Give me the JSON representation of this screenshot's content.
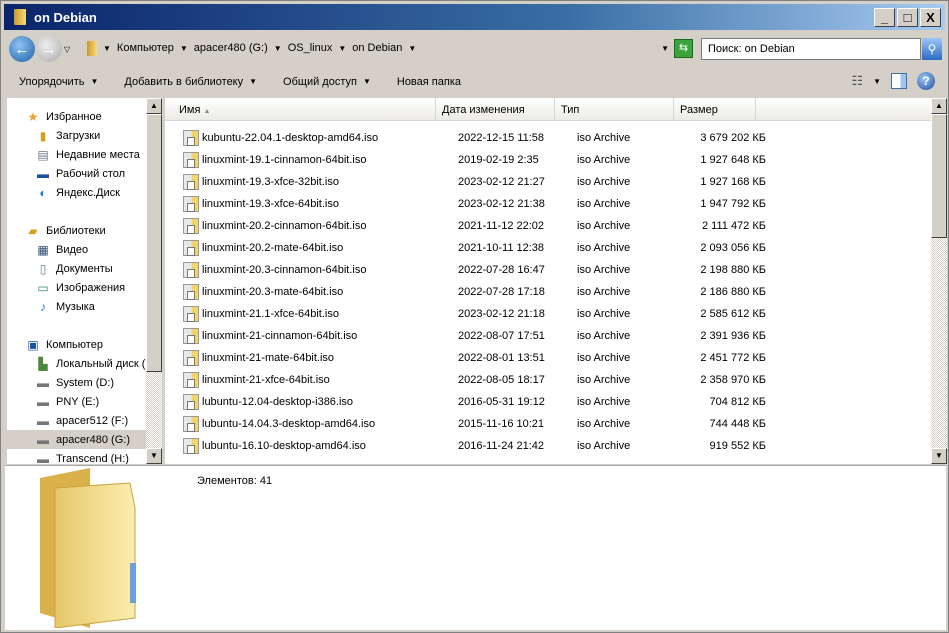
{
  "window": {
    "title": "on Debian",
    "minimize": "_",
    "maximize": "□",
    "close": "X"
  },
  "address": {
    "crumbs": [
      "Компьютер",
      "apacer480 (G:)",
      "OS_linux",
      "on Debian"
    ]
  },
  "search": {
    "placeholder": "Поиск: on Debian"
  },
  "toolbar": {
    "organize": "Упорядочить",
    "add_library": "Добавить в библиотеку",
    "share": "Общий доступ",
    "new_folder": "Новая папка",
    "help": "?"
  },
  "nav": {
    "favorites": {
      "label": "Избранное",
      "items": [
        "Загрузки",
        "Недавние места",
        "Рабочий стол",
        "Яндекс.Диск"
      ]
    },
    "libraries": {
      "label": "Библиотеки",
      "items": [
        "Видео",
        "Документы",
        "Изображения",
        "Музыка"
      ]
    },
    "computer": {
      "label": "Компьютер",
      "items": [
        "Локальный диск (C:)",
        "System (D:)",
        "PNY (E:)",
        "apacer512 (F:)",
        "apacer480 (G:)",
        "Transcend (H:)"
      ]
    },
    "selected": "apacer480 (G:)"
  },
  "columns": {
    "name": "Имя",
    "date": "Дата изменения",
    "type": "Тип",
    "size": "Размер"
  },
  "files": [
    {
      "name": "kubuntu-22.04.1-desktop-amd64.iso",
      "date": "2022-12-15 11:58",
      "type": "iso Archive",
      "size": "3 679 202 КБ"
    },
    {
      "name": "linuxmint-19.1-cinnamon-64bit.iso",
      "date": "2019-02-19 2:35",
      "type": "iso Archive",
      "size": "1 927 648 КБ"
    },
    {
      "name": "linuxmint-19.3-xfce-32bit.iso",
      "date": "2023-02-12 21:27",
      "type": "iso Archive",
      "size": "1 927 168 КБ"
    },
    {
      "name": "linuxmint-19.3-xfce-64bit.iso",
      "date": "2023-02-12 21:38",
      "type": "iso Archive",
      "size": "1 947 792 КБ"
    },
    {
      "name": "linuxmint-20.2-cinnamon-64bit.iso",
      "date": "2021-11-12 22:02",
      "type": "iso Archive",
      "size": "2 111 472 КБ"
    },
    {
      "name": "linuxmint-20.2-mate-64bit.iso",
      "date": "2021-10-11 12:38",
      "type": "iso Archive",
      "size": "2 093 056 КБ"
    },
    {
      "name": "linuxmint-20.3-cinnamon-64bit.iso",
      "date": "2022-07-28 16:47",
      "type": "iso Archive",
      "size": "2 198 880 КБ"
    },
    {
      "name": "linuxmint-20.3-mate-64bit.iso",
      "date": "2022-07-28 17:18",
      "type": "iso Archive",
      "size": "2 186 880 КБ"
    },
    {
      "name": "linuxmint-21.1-xfce-64bit.iso",
      "date": "2023-02-12 21:18",
      "type": "iso Archive",
      "size": "2 585 612 КБ"
    },
    {
      "name": "linuxmint-21-cinnamon-64bit.iso",
      "date": "2022-08-07 17:51",
      "type": "iso Archive",
      "size": "2 391 936 КБ"
    },
    {
      "name": "linuxmint-21-mate-64bit.iso",
      "date": "2022-08-01 13:51",
      "type": "iso Archive",
      "size": "2 451 772 КБ"
    },
    {
      "name": "linuxmint-21-xfce-64bit.iso",
      "date": "2022-08-05 18:17",
      "type": "iso Archive",
      "size": "2 358 970 КБ"
    },
    {
      "name": "lubuntu-12.04-desktop-i386.iso",
      "date": "2016-05-31 19:12",
      "type": "iso Archive",
      "size": "704 812 КБ"
    },
    {
      "name": "lubuntu-14.04.3-desktop-amd64.iso",
      "date": "2015-11-16 10:21",
      "type": "iso Archive",
      "size": "744 448 КБ"
    },
    {
      "name": "lubuntu-16.10-desktop-amd64.iso",
      "date": "2016-11-24 21:42",
      "type": "iso Archive",
      "size": "919 552 КБ"
    }
  ],
  "details": {
    "count": "Элементов: 41"
  }
}
